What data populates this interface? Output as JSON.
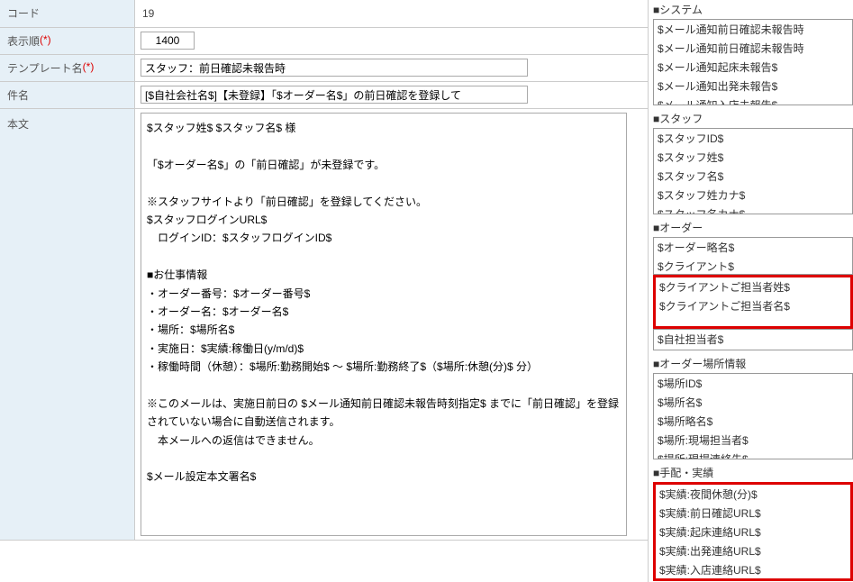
{
  "form": {
    "code": {
      "label": "コード",
      "value": "19"
    },
    "display_order": {
      "label": "表示順",
      "required": "(*)",
      "value": "1400"
    },
    "template_name": {
      "label": "テンプレート名",
      "required": "(*)",
      "value": "スタッフ：前日確認未報告時"
    },
    "subject": {
      "label": "件名",
      "value": "[$自社会社名$]【未登録】「$オーダー名$」の前日確認を登録して"
    },
    "body": {
      "label": "本文",
      "value": "$スタッフ姓$ $スタッフ名$ 様\n\n「$オーダー名$」の「前日確認」が未登録です。\n\n※スタッフサイトより「前日確認」を登録してください。\n$スタッフログインURL$\n　ログインID：$スタッフログインID$\n\n■お仕事情報\n・オーダー番号：$オーダー番号$\n・オーダー名：$オーダー名$\n・場所：$場所名$\n・実施日：$実績:稼働日(y/m/d)$\n・稼働時間（休憩）：$場所:勤務開始$ ～ $場所:勤務終了$（$場所:休憩(分)$ 分）\n\n※このメールは、実施日前日の $メール通知前日確認未報告時刻指定$ までに「前日確認」を登録されていない場合に自動送信されます。\n　本メールへの返信はできません。\n\n$メール設定本文署名$"
    }
  },
  "sidebar": {
    "groups": [
      {
        "title": "■システム",
        "items": [
          "$メール通知前日確認未報告時",
          "$メール通知前日確認未報告時",
          "$メール通知起床未報告$",
          "$メール通知出発未報告$",
          "$メール通知入店未報告$"
        ]
      },
      {
        "title": "■スタッフ",
        "items": [
          "$スタッフID$",
          "$スタッフ姓$",
          "$スタッフ名$",
          "$スタッフ姓カナ$",
          "$スタッフ名カナ$"
        ]
      },
      {
        "title": "■オーダー",
        "items_top": [
          "$オーダー略名$",
          "$クライアント$"
        ],
        "items_highlight": [
          "$クライアントご担当者姓$",
          "$クライアントご担当者名$"
        ],
        "items_bottom": [
          "$自社担当者$"
        ]
      },
      {
        "title": "■オーダー場所情報",
        "items": [
          "$場所ID$",
          "$場所名$",
          "$場所略名$",
          "$場所:現場担当者$",
          "$場所:現場連絡先$"
        ]
      },
      {
        "title": "■手配・実績",
        "items_highlight": [
          "$実績:夜間休憩(分)$",
          "$実績:前日確認URL$",
          "$実績:起床連絡URL$",
          "$実績:出発連絡URL$",
          "$実績:入店連絡URL$"
        ]
      }
    ]
  }
}
